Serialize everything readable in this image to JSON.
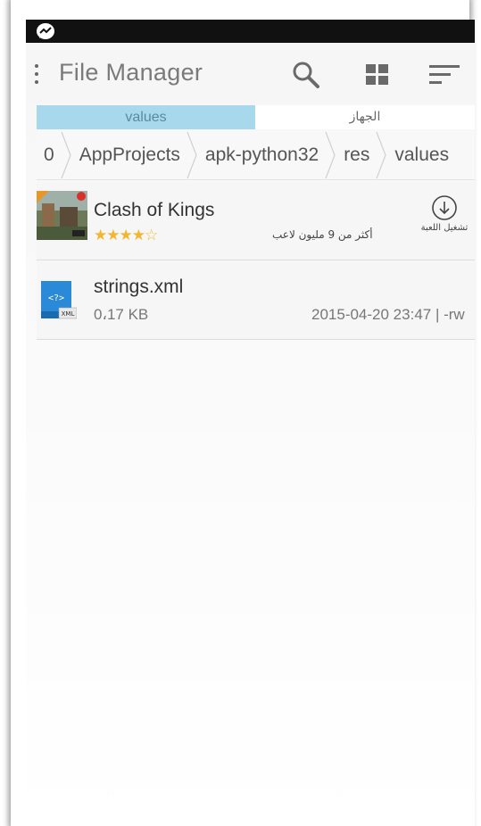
{
  "status_bar": {
    "icon": "messenger-icon"
  },
  "action_bar": {
    "title": "File Manager",
    "icons": [
      "overflow-menu-icon",
      "search-icon",
      "grid-view-icon",
      "sort-icon"
    ]
  },
  "tabs": [
    {
      "label": "values",
      "selected": true
    },
    {
      "label": "الجهاز",
      "selected": false
    }
  ],
  "breadcrumb": [
    "0",
    "AppProjects",
    "apk-python32",
    "res",
    "values"
  ],
  "ad": {
    "title": "Clash of Kings",
    "rating": 4.5,
    "stars": "★★★★☆",
    "tagline": "أكثر من 9 مليون لاعب",
    "action_label": "تشغيل اللعبة",
    "action_icon": "download-icon"
  },
  "files": [
    {
      "name": "strings.xml",
      "size": "0،17 KB",
      "meta": "2015-04-20 23:47 | -rw",
      "icon": "xml-file-icon",
      "icon_label": "XML"
    }
  ],
  "colors": {
    "tab_selected_bg": "#a8d8ec",
    "tab_selected_text": "#5a8aa0",
    "status_bar": "#111111",
    "star": "#f2b632"
  }
}
